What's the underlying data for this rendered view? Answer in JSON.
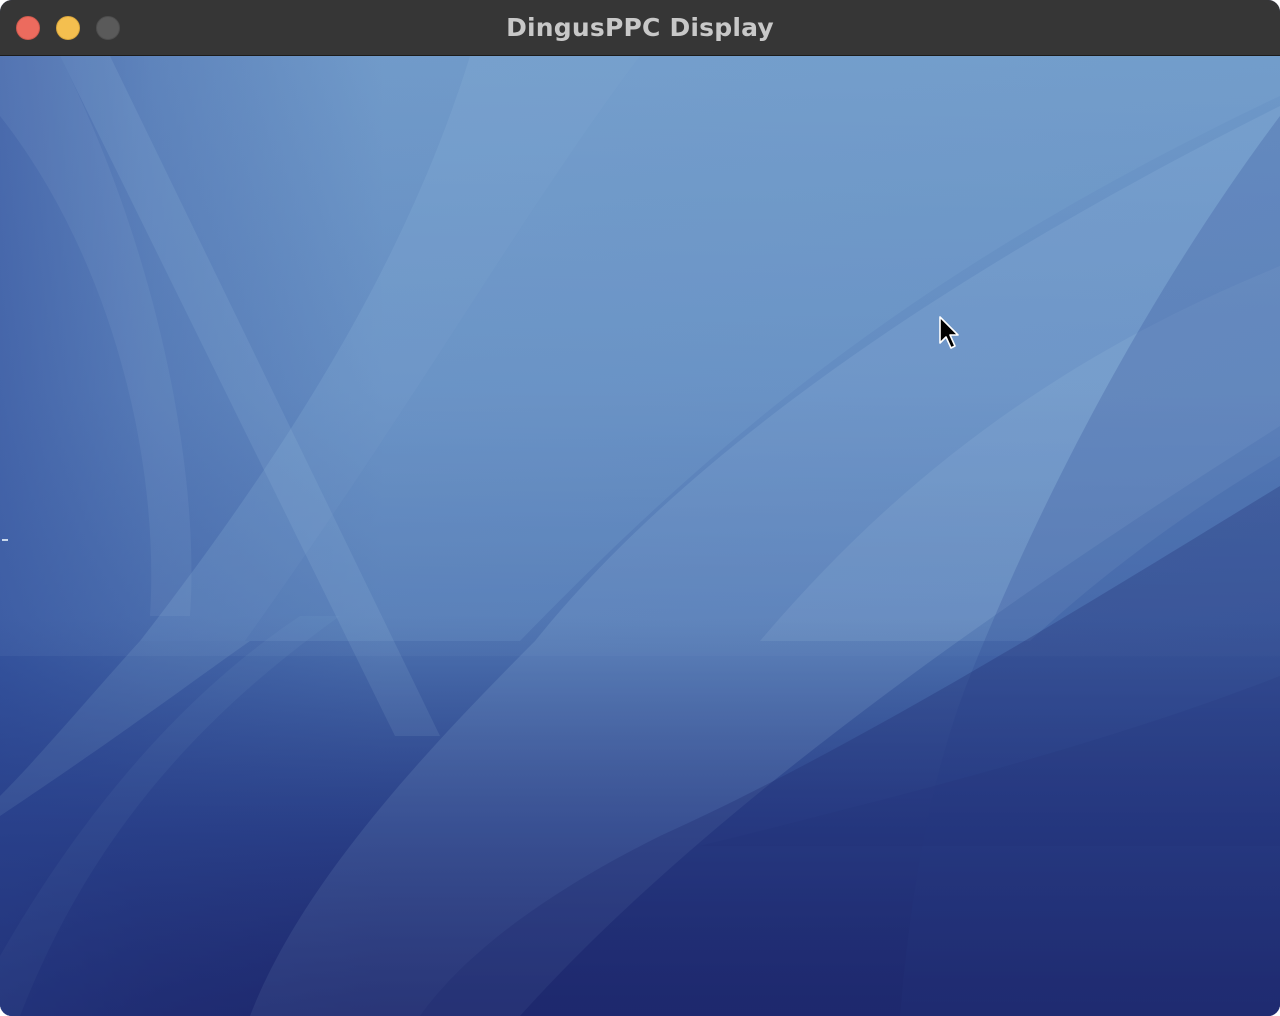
{
  "window": {
    "title": "DingusPPC Display"
  },
  "traffic_lights": {
    "close_icon": "close-icon",
    "minimize_icon": "minimize-icon",
    "zoom_icon": "zoom-icon",
    "close_color": "#ec6b5e",
    "minimize_color": "#f4bf4f",
    "zoom_color": "#5a5a5a"
  },
  "colors": {
    "titlebar": "#363636",
    "title_text": "#c8c8c8",
    "wallpaper_light": "#7aa4cc",
    "wallpaper_mid": "#4f74b0",
    "wallpaper_dark": "#1f2a72"
  },
  "desktop": {
    "cursor_icon": "arrow-cursor-icon"
  }
}
